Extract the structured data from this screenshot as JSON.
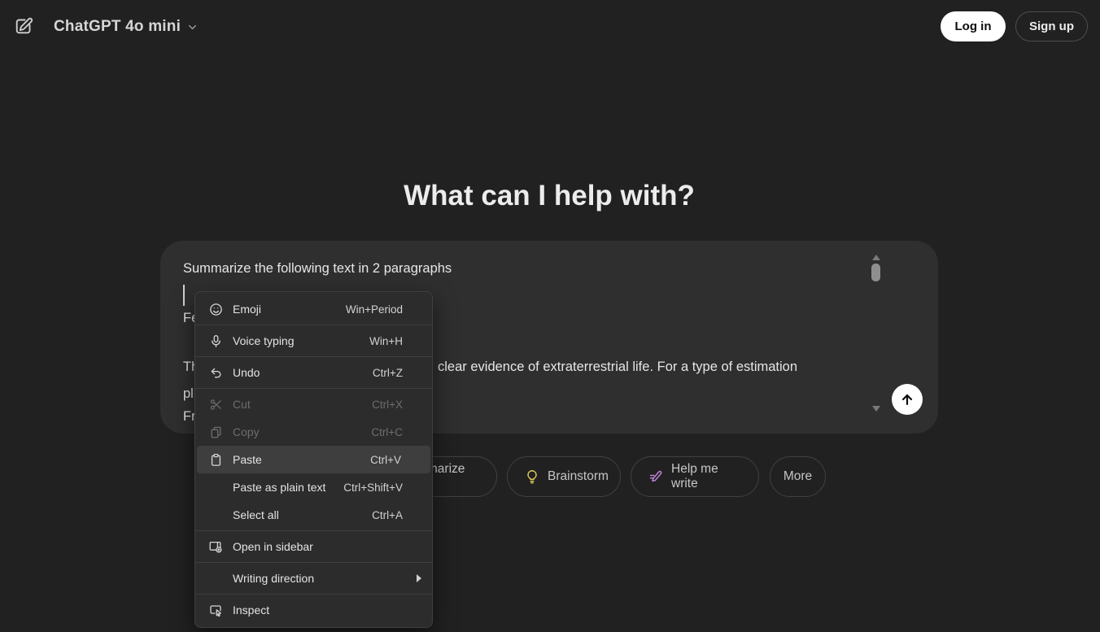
{
  "header": {
    "title": "ChatGPT 4o mini",
    "login_label": "Log in",
    "signup_label": "Sign up"
  },
  "main": {
    "heading": "What can I help with?"
  },
  "composer": {
    "line1": "Summarize the following text in 2 paragraphs",
    "fragments": {
      "f1": "Fe",
      "f2": "Th",
      "f3": "pl",
      "f4": "Fr"
    },
    "visible_line": "clear evidence of extraterrestrial life. For a type of estimation"
  },
  "chips": [
    {
      "label": "Summarize text",
      "icon": "document-icon",
      "icon_color": "#e8a33d"
    },
    {
      "label": "Brainstorm",
      "icon": "lightbulb-icon",
      "icon_color": "#e3c95e"
    },
    {
      "label": "Help me write",
      "icon": "pen-icon",
      "icon_color": "#bd81d6"
    },
    {
      "label": "More",
      "icon": ""
    }
  ],
  "context_menu": {
    "items": [
      {
        "label": "Emoji",
        "shortcut": "Win+Period",
        "icon": "emoji-icon",
        "state": "enabled"
      },
      {
        "label": "Voice typing",
        "shortcut": "Win+H",
        "icon": "microphone-icon",
        "state": "enabled"
      },
      {
        "label": "Undo",
        "shortcut": "Ctrl+Z",
        "icon": "undo-icon",
        "state": "enabled"
      },
      {
        "label": "Cut",
        "shortcut": "Ctrl+X",
        "icon": "scissors-icon",
        "state": "disabled"
      },
      {
        "label": "Copy",
        "shortcut": "Ctrl+C",
        "icon": "copy-icon",
        "state": "disabled"
      },
      {
        "label": "Paste",
        "shortcut": "Ctrl+V",
        "icon": "paste-icon",
        "state": "highlighted"
      },
      {
        "label": "Paste as plain text",
        "shortcut": "Ctrl+Shift+V",
        "icon": "",
        "state": "enabled"
      },
      {
        "label": "Select all",
        "shortcut": "Ctrl+A",
        "icon": "",
        "state": "enabled"
      },
      {
        "label": "Open in sidebar",
        "shortcut": "",
        "icon": "open-in-sidebar-icon",
        "state": "enabled"
      },
      {
        "label": "Writing direction",
        "shortcut": "",
        "icon": "",
        "state": "enabled",
        "has_submenu": true
      },
      {
        "label": "Inspect",
        "shortcut": "",
        "icon": "inspect-icon",
        "state": "enabled"
      }
    ]
  },
  "colors": {
    "page_bg": "#212121",
    "composer_bg": "#2f2f2f",
    "menu_bg": "#2c2c2c",
    "menu_highlight": "#3e3e3e",
    "login_button_bg": "#ffffff",
    "bulb_accent": "#e3c95e",
    "pen_accent": "#bd81d6",
    "document_accent": "#e8a33d"
  }
}
